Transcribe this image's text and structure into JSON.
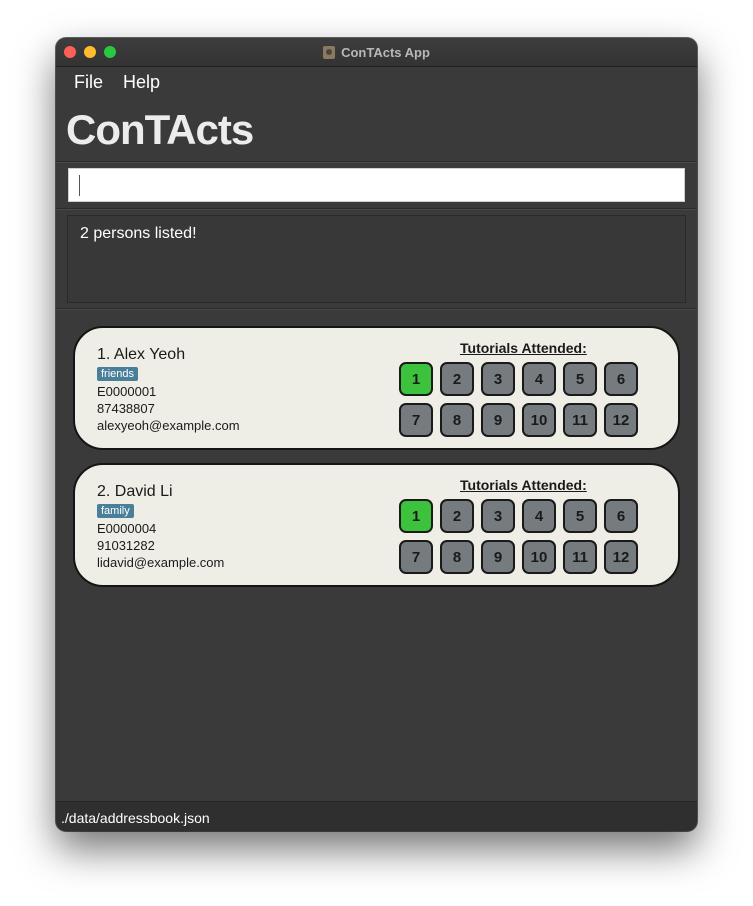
{
  "window": {
    "title": "ConTActs App"
  },
  "menu": {
    "items": [
      "File",
      "Help"
    ]
  },
  "brand": "ConTActs",
  "command": {
    "value": ""
  },
  "result": "2 persons listed!",
  "tutorials_label": "Tutorials Attended:",
  "persons": [
    {
      "name": "1. Alex Yeoh",
      "tag": "friends",
      "id": "E0000001",
      "phone": "87438807",
      "email": "alexyeoh@example.com",
      "tutorials": [
        {
          "label": "1",
          "attended": true
        },
        {
          "label": "2",
          "attended": false
        },
        {
          "label": "3",
          "attended": false
        },
        {
          "label": "4",
          "attended": false
        },
        {
          "label": "5",
          "attended": false
        },
        {
          "label": "6",
          "attended": false
        },
        {
          "label": "7",
          "attended": false
        },
        {
          "label": "8",
          "attended": false
        },
        {
          "label": "9",
          "attended": false
        },
        {
          "label": "10",
          "attended": false
        },
        {
          "label": "11",
          "attended": false
        },
        {
          "label": "12",
          "attended": false
        }
      ]
    },
    {
      "name": "2. David Li",
      "tag": "family",
      "id": "E0000004",
      "phone": "91031282",
      "email": "lidavid@example.com",
      "tutorials": [
        {
          "label": "1",
          "attended": true
        },
        {
          "label": "2",
          "attended": false
        },
        {
          "label": "3",
          "attended": false
        },
        {
          "label": "4",
          "attended": false
        },
        {
          "label": "5",
          "attended": false
        },
        {
          "label": "6",
          "attended": false
        },
        {
          "label": "7",
          "attended": false
        },
        {
          "label": "8",
          "attended": false
        },
        {
          "label": "9",
          "attended": false
        },
        {
          "label": "10",
          "attended": false
        },
        {
          "label": "11",
          "attended": false
        },
        {
          "label": "12",
          "attended": false
        }
      ]
    }
  ],
  "status_bar": "./data/addressbook.json",
  "colors": {
    "attended": "#3cc23c",
    "not_attended": "#767b80",
    "tag": "#4a7f9a",
    "card": "#efeee6"
  }
}
